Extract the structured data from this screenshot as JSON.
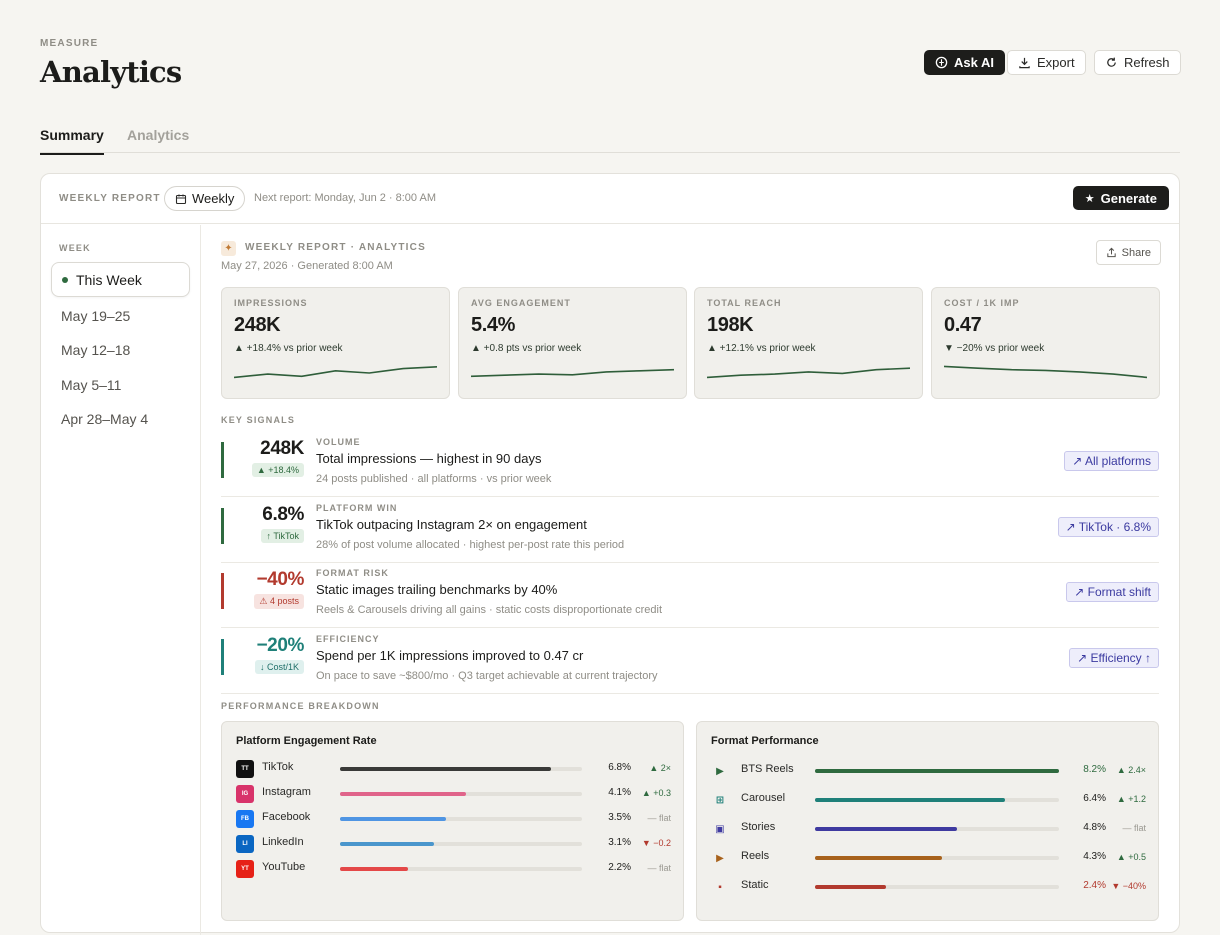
{
  "header": {
    "eyebrow": "MEASURE",
    "title": "Analytics",
    "ask_ai": "Ask AI",
    "export": "Export",
    "refresh": "Refresh"
  },
  "tabs": [
    {
      "label": "Summary"
    },
    {
      "label": "Analytics"
    }
  ],
  "report_bar": {
    "label": "WEEKLY REPORT",
    "frequency": "Weekly",
    "next_report": "Next report: Monday, Jun 2 · 8:00 AM",
    "generate": "Generate"
  },
  "weeks": {
    "heading": "WEEK",
    "items": [
      {
        "label": "This Week"
      },
      {
        "label": "May 19–25"
      },
      {
        "label": "May 12–18"
      },
      {
        "label": "May 5–11"
      },
      {
        "label": "Apr 28–May 4"
      }
    ]
  },
  "report": {
    "title": "WEEKLY REPORT · ANALYTICS",
    "date": "May 27, 2026 · Generated 8:00 AM",
    "share": "Share"
  },
  "kpis": [
    {
      "label": "IMPRESSIONS",
      "value": "248K",
      "delta": "▲ +18.4% vs prior week",
      "spark": [
        0.3,
        0.45,
        0.35,
        0.6,
        0.5,
        0.7,
        0.78
      ]
    },
    {
      "label": "AVG ENGAGEMENT",
      "value": "5.4%",
      "delta": "▲ +0.8 pts vs prior week",
      "spark": [
        0.35,
        0.4,
        0.45,
        0.42,
        0.55,
        0.6,
        0.65
      ]
    },
    {
      "label": "TOTAL REACH",
      "value": "198K",
      "delta": "▲ +12.1% vs prior week",
      "spark": [
        0.3,
        0.4,
        0.45,
        0.55,
        0.48,
        0.65,
        0.72
      ]
    },
    {
      "label": "COST / 1K IMP",
      "value": "0.47",
      "delta": "▼ −20% vs prior week",
      "spark": [
        0.8,
        0.72,
        0.65,
        0.62,
        0.55,
        0.45,
        0.3
      ]
    }
  ],
  "signals_heading": "KEY SIGNALS",
  "signals": [
    {
      "value": "248K",
      "badge": "▲ +18.4%",
      "category": "VOLUME",
      "headline": "Total impressions — highest in 90 days",
      "detail": "24 posts published · all platforms · vs prior week",
      "tag": "↗ All platforms",
      "color": "#2f6a3f",
      "badge_bg": "#e2efe4",
      "badge_fg": "#2f6a3f",
      "value_fg": "#1c1c1a"
    },
    {
      "value": "6.8%",
      "badge": "↑ TikTok",
      "category": "PLATFORM WIN",
      "headline": "TikTok outpacing Instagram 2× on engagement",
      "detail": "28% of post volume allocated · highest per-post rate this period",
      "tag": "↗ TikTok · 6.8%",
      "color": "#2f6a3f",
      "badge_bg": "#e2efe4",
      "badge_fg": "#2f6a3f",
      "value_fg": "#1c1c1a"
    },
    {
      "value": "−40%",
      "badge": "⚠ 4 posts",
      "category": "FORMAT RISK",
      "headline": "Static images trailing benchmarks by 40%",
      "detail": "Reels & Carousels driving all gains · static costs disproportionate credit",
      "tag": "↗ Format shift",
      "color": "#b23a2e",
      "badge_bg": "#f7e3e0",
      "badge_fg": "#b23a2e",
      "value_fg": "#b23a2e"
    },
    {
      "value": "−20%",
      "badge": "↓ Cost/1K",
      "category": "EFFICIENCY",
      "headline": "Spend per 1K impressions improved to 0.47 cr",
      "detail": "On pace to save ~$800/mo · Q3 target achievable at current trajectory",
      "tag": "↗ Efficiency ↑",
      "color": "#1f8079",
      "badge_bg": "#dff0ee",
      "badge_fg": "#1f6f69",
      "value_fg": "#1f8079"
    }
  ],
  "breakdown_heading": "PERFORMANCE BREAKDOWN",
  "platform_panel": {
    "title": "Platform Engagement Rate",
    "rows": [
      {
        "abbr": "TT",
        "name": "TikTok",
        "value": "6.8%",
        "fill": 0.87,
        "delta": "▲ 2×",
        "color": "#3a3a38",
        "logo": "#111111",
        "delta_color": "#2f6a3f"
      },
      {
        "abbr": "IG",
        "name": "Instagram",
        "value": "4.1%",
        "fill": 0.52,
        "delta": "▲ +0.3",
        "color": "#e0648a",
        "logo": "#d8336a",
        "delta_color": "#2f6a3f"
      },
      {
        "abbr": "FB",
        "name": "Facebook",
        "value": "3.5%",
        "fill": 0.44,
        "delta": "— flat",
        "color": "#4f95e3",
        "logo": "#1877f2",
        "delta_color": "#9a9891"
      },
      {
        "abbr": "LI",
        "name": "LinkedIn",
        "value": "3.1%",
        "fill": 0.39,
        "delta": "▼ −0.2",
        "color": "#4a96cc",
        "logo": "#0a66c2",
        "delta_color": "#b23a2e"
      },
      {
        "abbr": "YT",
        "name": "YouTube",
        "value": "2.2%",
        "fill": 0.28,
        "delta": "— flat",
        "color": "#e44848",
        "logo": "#e62117",
        "delta_color": "#9a9891"
      }
    ]
  },
  "format_panel": {
    "title": "Format Performance",
    "rows": [
      {
        "icon": "▶",
        "name": "BTS Reels",
        "value": "8.2%",
        "fill": 1.0,
        "delta": "▲ 2.4×",
        "color": "#2f6a3f",
        "icon_color": "#2f6a3f",
        "delta_color": "#2f6a3f",
        "value_color": "#2f6a3f"
      },
      {
        "icon": "⊞",
        "name": "Carousel",
        "value": "6.4%",
        "fill": 0.78,
        "delta": "▲ +1.2",
        "color": "#1f8079",
        "icon_color": "#1f8079",
        "delta_color": "#2f6a3f",
        "value_color": "#1c1c1a"
      },
      {
        "icon": "▣",
        "name": "Stories",
        "value": "4.8%",
        "fill": 0.58,
        "delta": "— flat",
        "color": "#3f3aa0",
        "icon_color": "#3f3aa0",
        "delta_color": "#9a9891",
        "value_color": "#1c1c1a"
      },
      {
        "icon": "▶",
        "name": "Reels",
        "value": "4.3%",
        "fill": 0.52,
        "delta": "▲ +0.5",
        "color": "#a8621c",
        "icon_color": "#a8621c",
        "delta_color": "#2f6a3f",
        "value_color": "#1c1c1a"
      },
      {
        "icon": "▪",
        "name": "Static",
        "value": "2.4%",
        "fill": 0.29,
        "delta": "▼ −40%",
        "color": "#b23a2e",
        "icon_color": "#b23a2e",
        "delta_color": "#b23a2e",
        "value_color": "#b23a2e"
      }
    ]
  }
}
